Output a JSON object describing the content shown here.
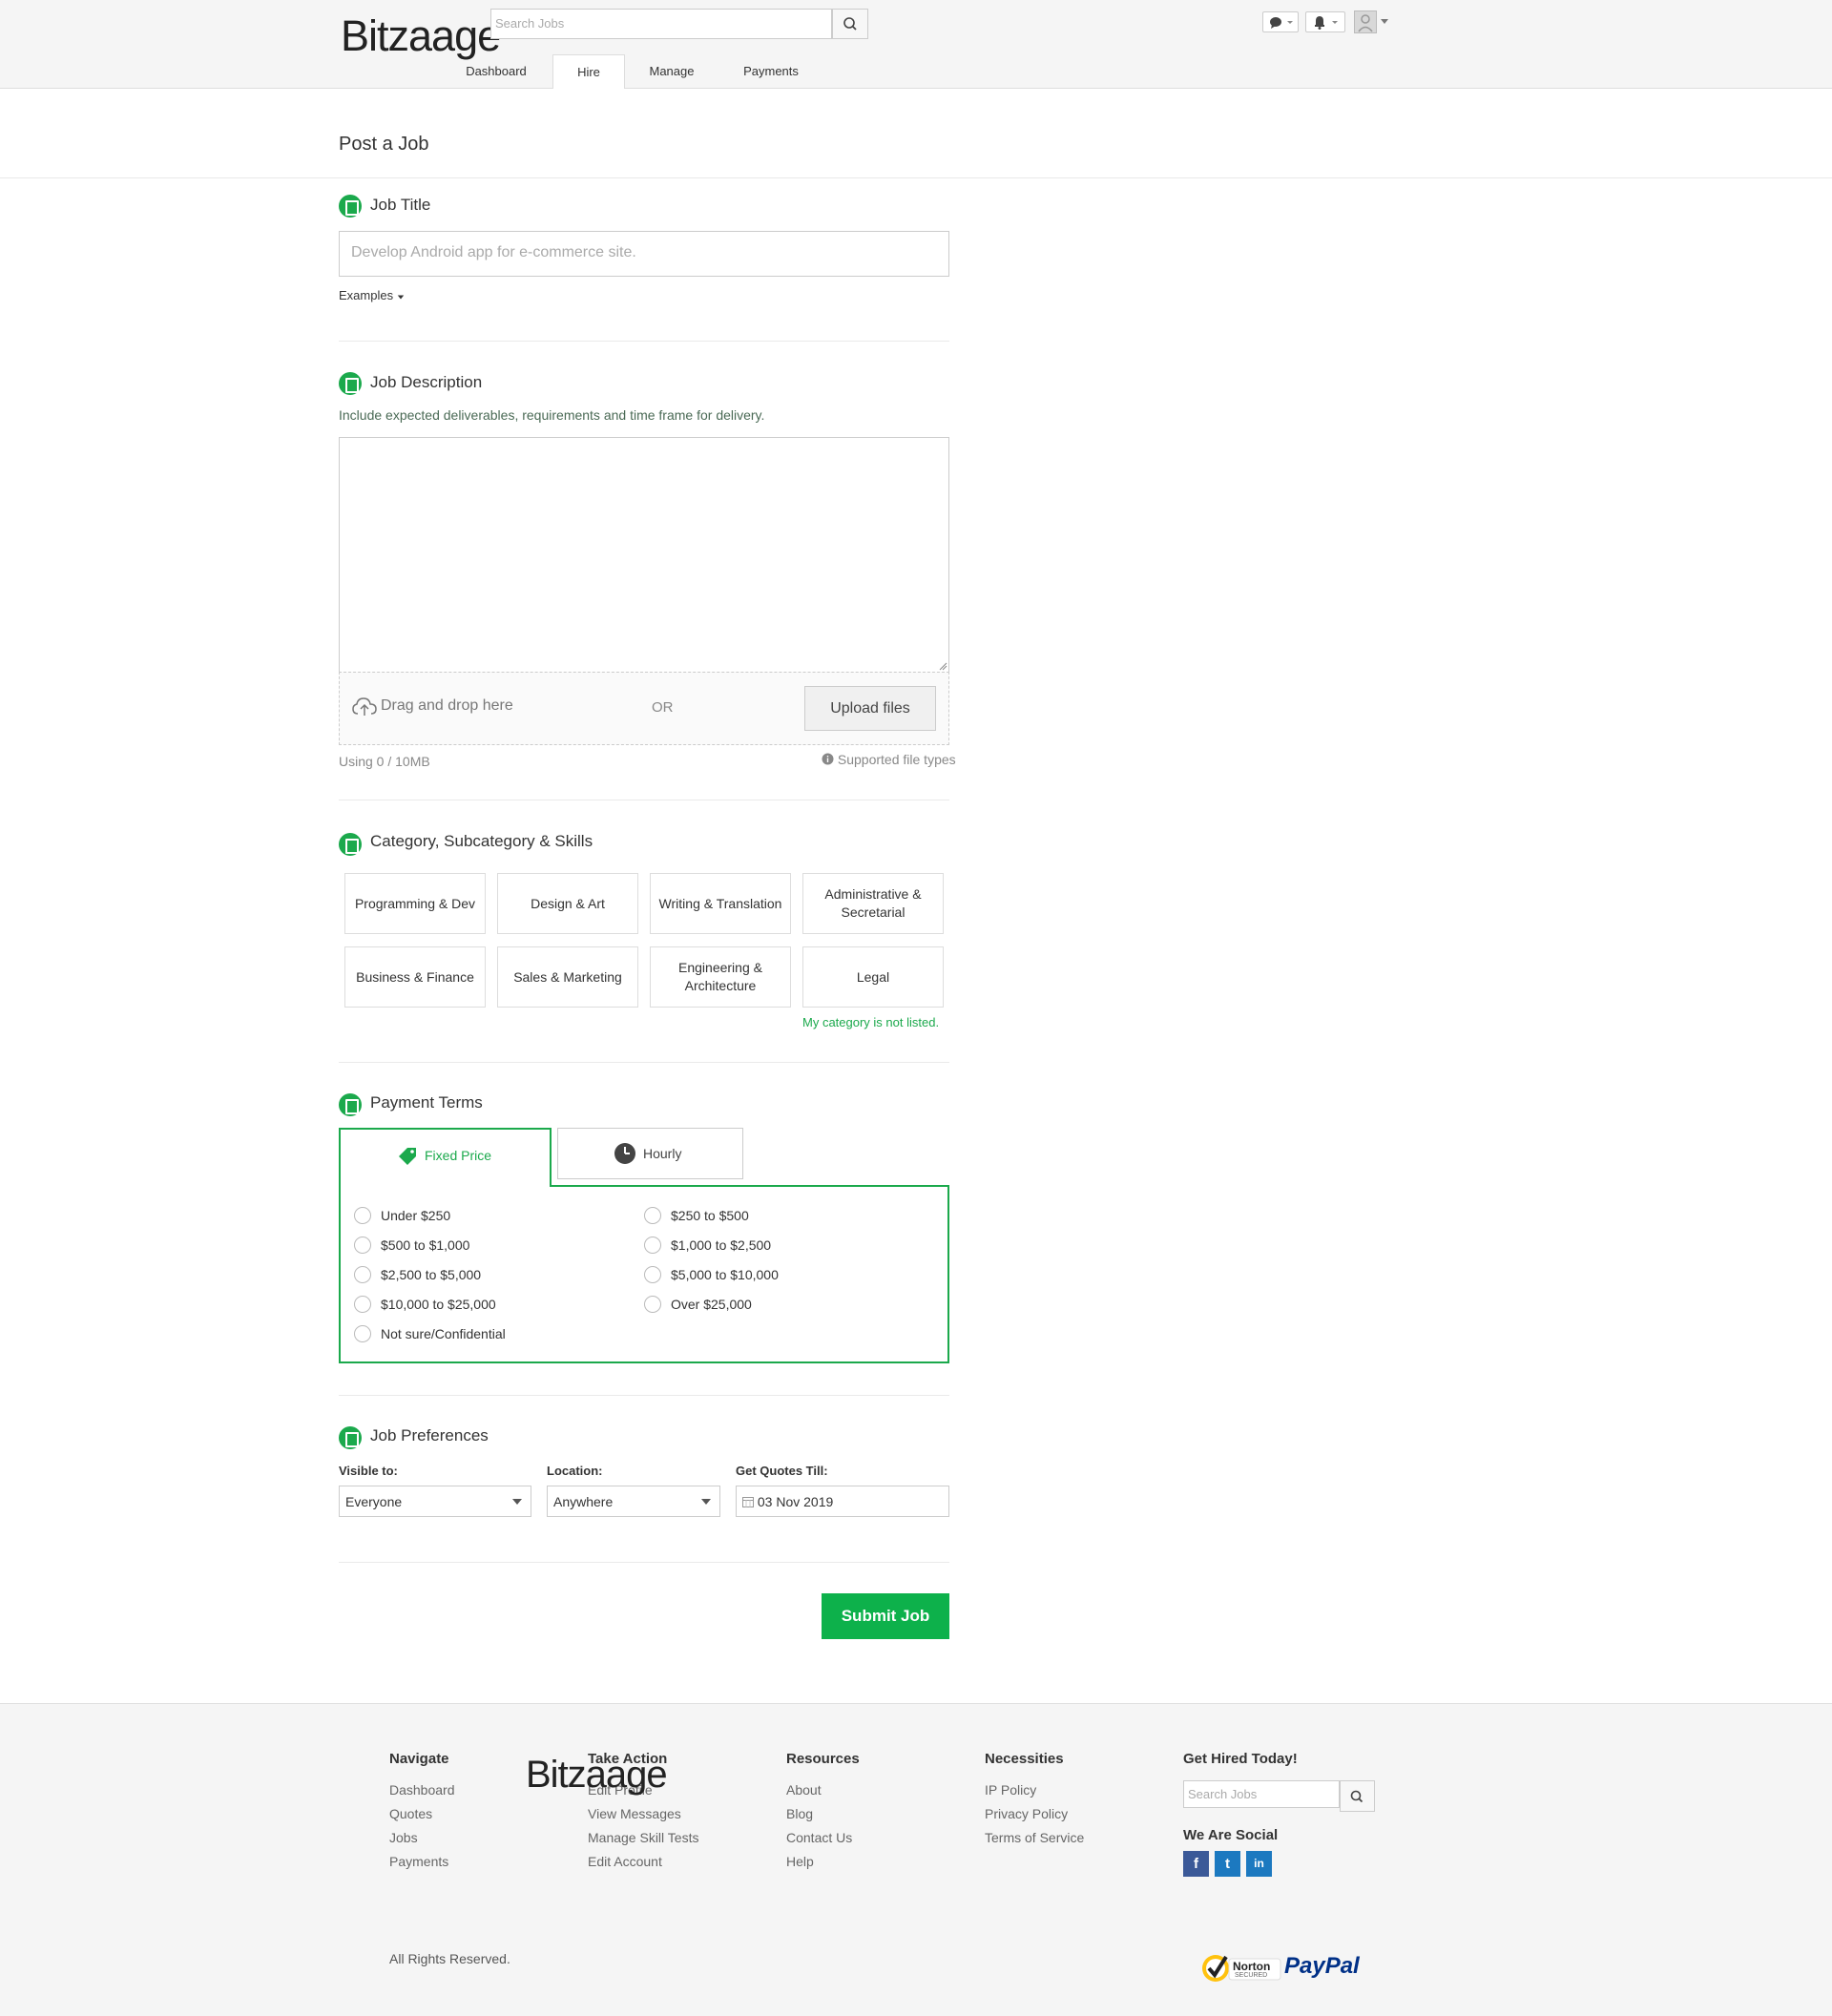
{
  "header": {
    "logo": "Bitzaage",
    "search_placeholder": "Search Jobs",
    "nav": [
      "Dashboard",
      "Hire",
      "Manage",
      "Payments"
    ],
    "active_tab": "Hire"
  },
  "page_title": "Post a Job",
  "job_title": {
    "heading": "Job Title",
    "placeholder": "Develop Android app for e-commerce site.",
    "examples_label": "Examples"
  },
  "job_description": {
    "heading": "Job Description",
    "hint": "Include expected deliverables, requirements and time frame for delivery.",
    "drag_text": "Drag and drop here",
    "or_text": "OR",
    "upload_label": "Upload files",
    "usage": "Using 0 / 10MB",
    "supported": "Supported file types"
  },
  "category": {
    "heading": "Category, Subcategory & Skills",
    "items": [
      "Programming & Dev",
      "Design & Art",
      "Writing & Translation",
      "Administrative & Secretarial",
      "Business & Finance",
      "Sales & Marketing",
      "Engineering & Architecture",
      "Legal"
    ],
    "not_listed": "My category is not listed."
  },
  "payment": {
    "heading": "Payment Terms",
    "tabs": [
      "Fixed Price",
      "Hourly"
    ],
    "active_tab": "Fixed Price",
    "options_left": [
      "Under $250",
      "$500 to $1,000",
      "$2,500 to $5,000",
      "$10,000 to $25,000",
      "Not sure/Confidential"
    ],
    "options_right": [
      "$250 to $500",
      "$1,000 to $2,500",
      "$5,000 to $10,000",
      "Over $25,000"
    ]
  },
  "preferences": {
    "heading": "Job Preferences",
    "visible_label": "Visible to:",
    "visible_value": "Everyone",
    "location_label": "Location:",
    "location_value": "Anywhere",
    "quotes_label": "Get Quotes Till:",
    "quotes_value": "03 Nov 2019"
  },
  "submit_label": "Submit Job",
  "footer": {
    "logo": "Bitzaage",
    "columns": [
      {
        "heading": "Navigate",
        "links": [
          "Dashboard",
          "Quotes",
          "Jobs",
          "Payments"
        ]
      },
      {
        "heading": "Take Action",
        "links": [
          "Edit Profile",
          "View Messages",
          "Manage Skill Tests",
          "Edit Account"
        ]
      },
      {
        "heading": "Resources",
        "links": [
          "About",
          "Blog",
          "Contact Us",
          "Help"
        ]
      },
      {
        "heading": "Necessities",
        "links": [
          "IP Policy",
          "Privacy Policy",
          "Terms of Service"
        ]
      }
    ],
    "hired_heading": "Get Hired Today!",
    "search_placeholder": "Search Jobs",
    "social_heading": "We Are Social",
    "social": [
      "f",
      "t",
      "in"
    ],
    "rights": "All Rights Reserved.",
    "norton": "Norton",
    "norton_sub": "SECURED",
    "paypal": "PayPal"
  },
  "colors": {
    "accent": "#1ba94c",
    "submit": "#0db14b",
    "facebook": "#3b5998",
    "social": "#1c79c0"
  }
}
